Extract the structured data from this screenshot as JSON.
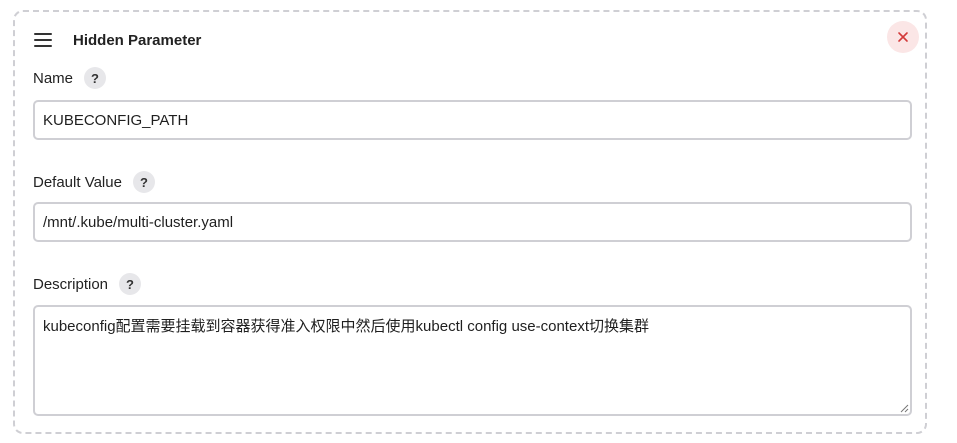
{
  "parameter": {
    "title": "Hidden Parameter",
    "fields": {
      "name": {
        "label": "Name",
        "help": "?",
        "value": "KUBECONFIG_PATH"
      },
      "default_value": {
        "label": "Default Value",
        "help": "?",
        "value": "/mnt/.kube/multi-cluster.yaml"
      },
      "description": {
        "label": "Description",
        "help": "?",
        "value": "kubeconfig配置需要挂载到容器获得准入权限中然后使用kubectl config use-context切换集群"
      }
    }
  },
  "icons": {
    "drag": "hamburger-drag-icon",
    "close": "close-icon",
    "close_color": "#d33a3a"
  }
}
